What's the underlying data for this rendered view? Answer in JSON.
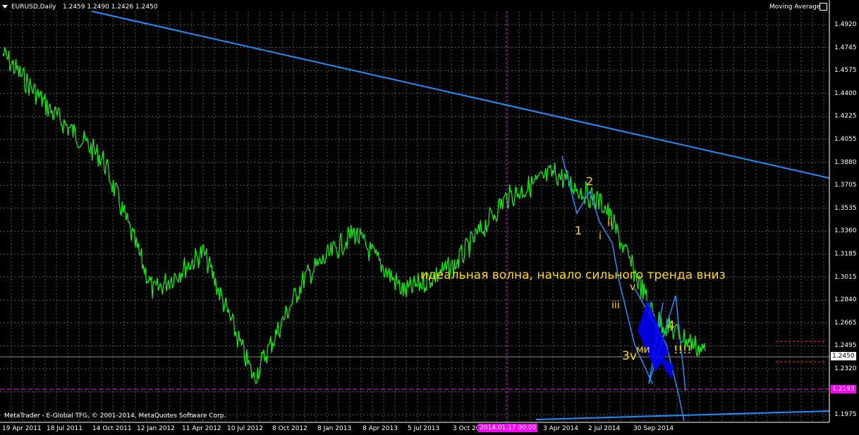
{
  "header": {
    "menu_icon": "triangle-down-icon",
    "symbol": "EURUSD,Daily",
    "ohlc": "1.2459 1.2490 1.2426 1.2450",
    "indicator": "Moving Average"
  },
  "footer": {
    "copyright": "MetaTrader - E-Global TFG, © 2001-2014, MetaQuotes Software Corp.",
    "cursor_date": "2014.01.17 00:00"
  },
  "price_axis": {
    "labels": [
      "1.4920",
      "1.4745",
      "1.4575",
      "1.4400",
      "1.4225",
      "1.4055",
      "1.3880",
      "1.3705",
      "1.3535",
      "1.3360",
      "1.3185",
      "1.3015",
      "1.2840",
      "1.2665",
      "1.2495",
      "1.2320",
      "1.2145",
      "1.1975"
    ],
    "current_price": "1.2450",
    "magenta_level": "1.2193"
  },
  "date_axis": {
    "labels": [
      "19 Apr 2011",
      "18 Jul 2011",
      "14 Oct 2011",
      "12 Jan 2012",
      "11 Apr 2012",
      "10 Jul 2012",
      "8 Oct 2012",
      "8 Jan 2013",
      "8 Apr 2013",
      "5 Jul 2013",
      "3 Oct 2013",
      "3 Apr 2014",
      "2 Jul 2014",
      "30 Sep 2014"
    ]
  },
  "annotations": {
    "main_text": "идеальная волна, начало сильного тренда вниз",
    "wave_1": "1",
    "wave_2": "2",
    "wave_i": "i",
    "wave_ii": "ii",
    "wave_iii": "iii",
    "wave_v": "v",
    "wave_3v": "3v",
    "wave_4": "4",
    "mini_text": "ми",
    "exclaim": "!!!!"
  },
  "colors": {
    "background": "#000000",
    "price_line": "#00ff00",
    "trendline": "#1e90ff",
    "annotation": "#ffd700",
    "magenta": "#ff00ff",
    "current_price_box": "#ffffff",
    "triangle_fill": "#0000ff"
  },
  "chart_data": {
    "type": "line",
    "title": "EURUSD,Daily",
    "ylim": [
      1.1975,
      1.492
    ],
    "x": [
      "19 Apr 2011",
      "18 Jul 2011",
      "14 Oct 2011",
      "12 Jan 2012",
      "11 Apr 2012",
      "10 Jul 2012",
      "8 Oct 2012",
      "8 Jan 2013",
      "8 Apr 2013",
      "5 Jul 2013",
      "3 Oct 2013",
      "3 Apr 2014",
      "2 Jul 2014",
      "30 Sep 2014"
    ],
    "series": [
      {
        "name": "EURUSD",
        "values": [
          1.47,
          1.425,
          1.39,
          1.29,
          1.32,
          1.225,
          1.3,
          1.335,
          1.29,
          1.31,
          1.36,
          1.38,
          1.355,
          1.27,
          1.245
        ]
      }
    ]
  }
}
